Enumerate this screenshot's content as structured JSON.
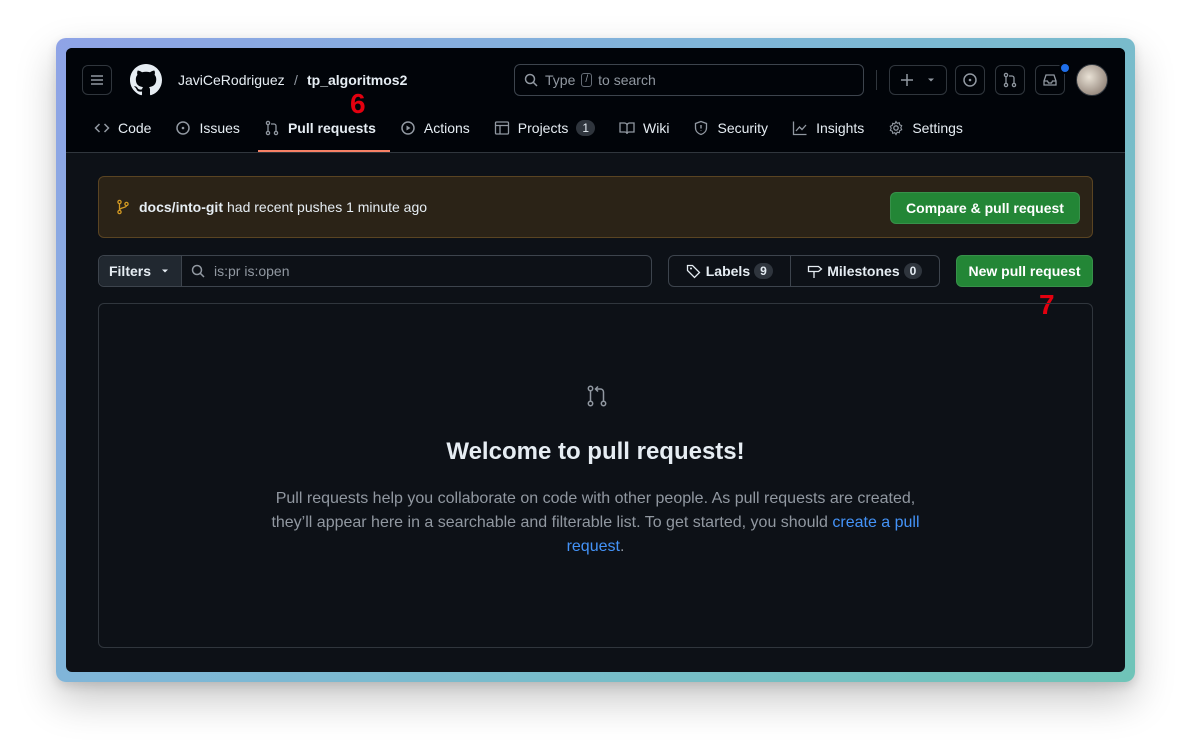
{
  "header": {
    "owner": "JaviCeRodriguez",
    "separator": "/",
    "repo": "tp_algoritmos2",
    "search_placeholder_prefix": "Type",
    "search_key": "/",
    "search_placeholder_suffix": "to search"
  },
  "tabs": [
    {
      "label": "Code",
      "icon": "code-icon"
    },
    {
      "label": "Issues",
      "icon": "issue-icon"
    },
    {
      "label": "Pull requests",
      "icon": "pull-request-icon",
      "active": true
    },
    {
      "label": "Actions",
      "icon": "play-icon"
    },
    {
      "label": "Projects",
      "icon": "table-icon",
      "count": "1"
    },
    {
      "label": "Wiki",
      "icon": "book-icon"
    },
    {
      "label": "Security",
      "icon": "shield-icon"
    },
    {
      "label": "Insights",
      "icon": "graph-icon"
    },
    {
      "label": "Settings",
      "icon": "gear-icon"
    }
  ],
  "annotations": {
    "step6": "6",
    "step7": "7"
  },
  "banner": {
    "branch": "docs/into-git",
    "message": "had recent pushes 1 minute ago",
    "button": "Compare & pull request"
  },
  "toolbar": {
    "filters_label": "Filters",
    "search_value": "is:pr is:open",
    "labels_label": "Labels",
    "labels_count": "9",
    "milestones_label": "Milestones",
    "milestones_count": "0",
    "new_pr_button": "New pull request"
  },
  "empty_state": {
    "title": "Welcome to pull requests!",
    "text": "Pull requests help you collaborate on code with other people. As pull requests are created, they’ll appear here in a searchable and filterable list. To get started, you should ",
    "link": "create a pull request",
    "end": "."
  },
  "colors": {
    "background": "#0d1117",
    "header": "#010409",
    "accent_underline": "#f78166",
    "green": "#238636",
    "link": "#4493f8",
    "annotation": "#e3000f",
    "notification": "#1f6feb"
  }
}
